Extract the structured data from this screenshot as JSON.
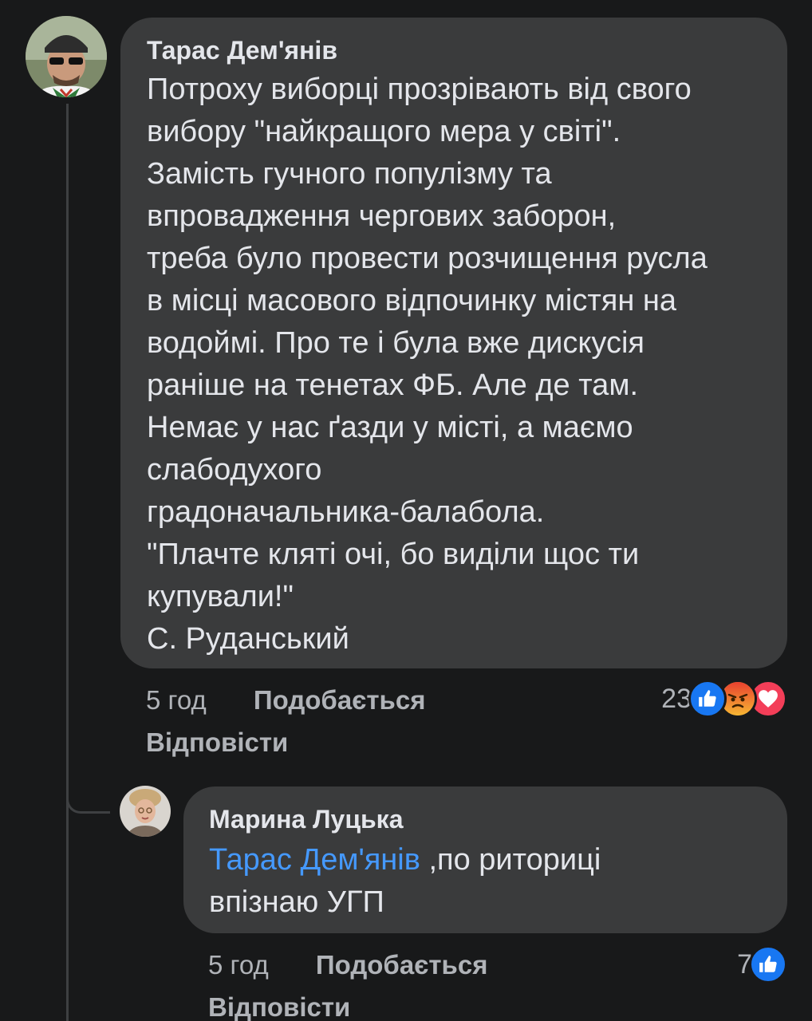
{
  "comments": [
    {
      "author": "Тарас Дем'янів",
      "lines": [
        "Потроху виборці прозрівають від свого",
        "вибору \"найкращого мера у світі\".",
        "Замість гучного популізму та",
        "впровадження чергових заборон,",
        "треба було провести розчищення русла",
        "в місці масового відпочинку містян на",
        "водоймі. Про те і була вже дискусія",
        "раніше на тенетах ФБ. Але де там.",
        "Немає у нас ґазди у місті, а маємо",
        "слабодухого",
        "градоначальника-балабола.",
        "\"Плачте кляті очі, бо виділи щос ти",
        "купували!\"",
        "С. Руданський"
      ],
      "time": "5 год",
      "like_label": "Подобається",
      "reply_label": "Відповісти",
      "reaction_count": "23",
      "reactions": [
        "like-icon",
        "angry-icon",
        "love-icon"
      ]
    },
    {
      "author": "Марина Луцька",
      "mention": "Тарас Дем'янів",
      "line1_rest": " ,по риториці",
      "line2": "впізнаю УГП",
      "time": "5 год",
      "like_label": "Подобається",
      "reply_label": "Відповісти",
      "reaction_count": "7",
      "reactions": [
        "like-icon"
      ]
    }
  ],
  "colors": {
    "background": "#18191a",
    "bubble": "#3a3b3c",
    "text": "#e4e6eb",
    "meta": "#b0b3b8",
    "mention": "#4599ff",
    "like": "#1877f2",
    "angry": "#f0a83a",
    "love": "#f33e58"
  }
}
